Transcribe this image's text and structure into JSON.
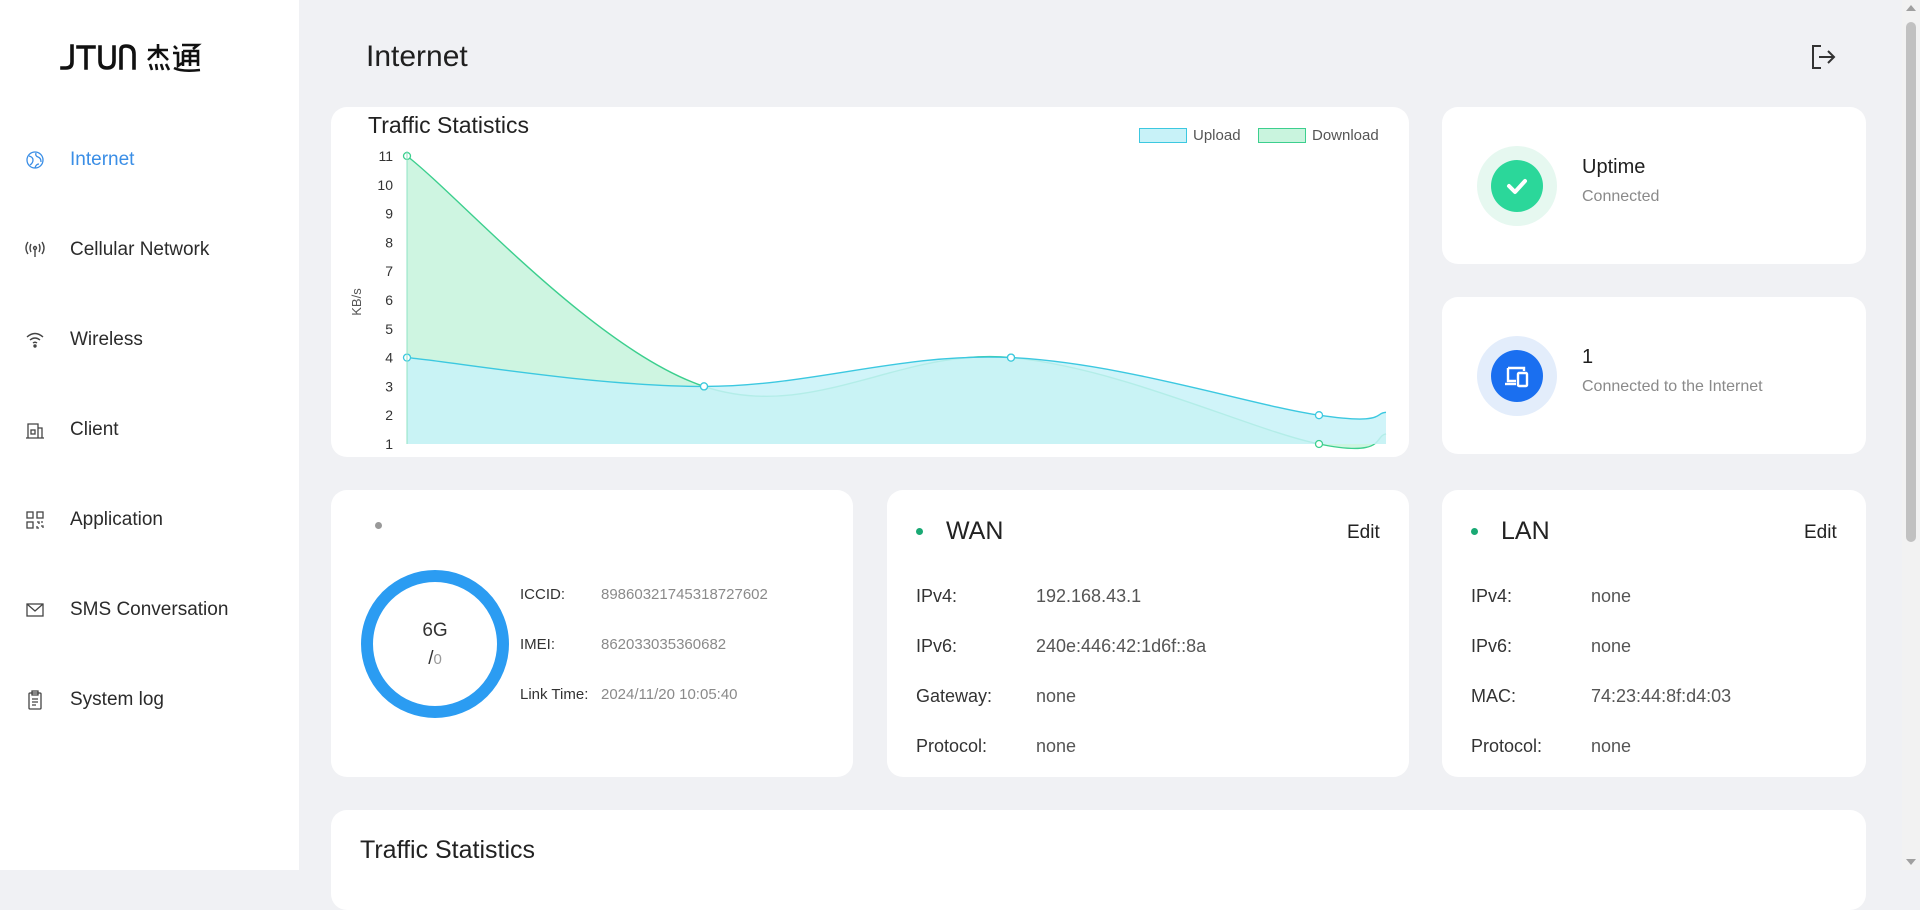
{
  "brand": {
    "logo_text": "JTUN 杰通"
  },
  "sidebar": {
    "items": [
      {
        "label": "Internet",
        "icon": "globe-icon",
        "active": true
      },
      {
        "label": "Cellular Network",
        "icon": "antenna-icon",
        "active": false
      },
      {
        "label": "Wireless",
        "icon": "wifi-icon",
        "active": false
      },
      {
        "label": "Client",
        "icon": "client-icon",
        "active": false
      },
      {
        "label": "Application",
        "icon": "grid-icon",
        "active": false
      },
      {
        "label": "SMS Conversation",
        "icon": "mail-icon",
        "active": false
      },
      {
        "label": "System log",
        "icon": "clipboard-icon",
        "active": false
      }
    ]
  },
  "header": {
    "title": "Internet",
    "logout_icon": "logout-icon"
  },
  "traffic_card": {
    "title": "Traffic Statistics",
    "legend": {
      "upload": "Upload",
      "download": "Download"
    },
    "ylabel": "KB/s"
  },
  "chart_data": {
    "type": "area",
    "title": "Traffic Statistics",
    "ylabel": "KB/s",
    "xlabel": "",
    "ylim": [
      1,
      11
    ],
    "yticks": [
      "1",
      "2",
      "3",
      "4",
      "5",
      "6",
      "7",
      "8",
      "9",
      "10",
      "11"
    ],
    "x": [
      0,
      1,
      2,
      3
    ],
    "series": [
      {
        "name": "Upload",
        "values": [
          4,
          3,
          4,
          2
        ],
        "color": "#3cc8e0",
        "fill": "#c8f2f8"
      },
      {
        "name": "Download",
        "values": [
          11,
          3,
          4,
          1
        ],
        "color": "#3ccf8e",
        "fill": "#c9f4de"
      }
    ],
    "legend": "top-right",
    "grid": false
  },
  "uptime": {
    "title": "Uptime",
    "status": "Connected",
    "icon": "check-icon",
    "color": "#2bd79a"
  },
  "devices": {
    "count": "1",
    "label": "Connected to the Internet",
    "icon": "devices-icon",
    "color": "#1a6ff0"
  },
  "sim": {
    "ring_value": "6G",
    "ring_sub_prefix": "/",
    "ring_sub": "0",
    "ring_color": "#2b9cf2",
    "iccid_label": "ICCID:",
    "iccid": "89860321745318727602",
    "imei_label": "IMEI:",
    "imei": "862033035360682",
    "linktime_label": "Link Time:",
    "linktime": "2024/11/20 10:05:40"
  },
  "wan": {
    "title": "WAN",
    "edit": "Edit",
    "rows": [
      {
        "k": "IPv4:",
        "v": "192.168.43.1"
      },
      {
        "k": "IPv6:",
        "v": "240e:446:42:1d6f::8a"
      },
      {
        "k": "Gateway:",
        "v": "none"
      },
      {
        "k": "Protocol:",
        "v": "none"
      }
    ]
  },
  "lan": {
    "title": "LAN",
    "edit": "Edit",
    "rows": [
      {
        "k": "IPv4:",
        "v": "none"
      },
      {
        "k": "IPv6:",
        "v": "none"
      },
      {
        "k": "MAC:",
        "v": "74:23:44:8f:d4:03"
      },
      {
        "k": "Protocol:",
        "v": "none"
      }
    ]
  },
  "bottom_card": {
    "title": "Traffic Statistics"
  }
}
